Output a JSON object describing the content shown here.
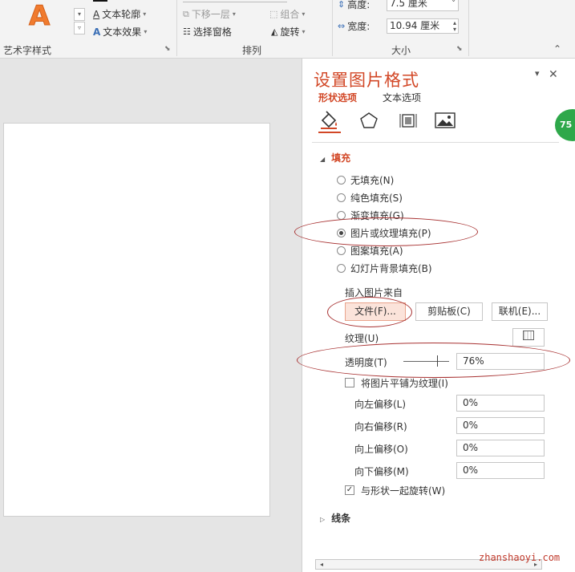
{
  "ribbon": {
    "wordart_group_label": "艺术字样式",
    "text_outline": "文本轮廓",
    "text_effects": "文本效果",
    "arrange_group_label": "排列",
    "send_backward": "下移一层",
    "group": "组合",
    "selection_pane": "选择窗格",
    "rotate": "旋转",
    "size_group_label": "大小",
    "height_label": "高度:",
    "height_value": "7.5 厘米",
    "width_label": "宽度:",
    "width_value": "10.94 厘米"
  },
  "pane": {
    "title": "设置图片格式",
    "tabs": [
      "形状选项",
      "文本选项"
    ],
    "fill_section": "填充",
    "fill_options": [
      "无填充(N)",
      "纯色填充(S)",
      "渐变填充(G)",
      "图片或纹理填充(P)",
      "图案填充(A)",
      "幻灯片背景填充(B)"
    ],
    "selected_fill": "图片或纹理填充(P)",
    "insert_from_label": "插入图片来自",
    "file_button": "文件(F)...",
    "clipboard_button": "剪贴板(C)",
    "online_button": "联机(E)...",
    "texture_label": "纹理(U)",
    "transparency_label": "透明度(T)",
    "transparency_value": "76%",
    "transparency_fraction": 0.76,
    "tile_label": "将图片平铺为纹理(I)",
    "tile_checked": false,
    "offsets": [
      {
        "label": "向左偏移(L)",
        "value": "0%"
      },
      {
        "label": "向右偏移(R)",
        "value": "0%"
      },
      {
        "label": "向上偏移(O)",
        "value": "0%"
      },
      {
        "label": "向下偏移(M)",
        "value": "0%"
      }
    ],
    "rotate_with_shape_label": "与形状一起旋转(W)",
    "rotate_with_shape_checked": true,
    "line_section": "线条"
  },
  "badge_text": "75",
  "watermark": "zhanshaoyi.com",
  "colors": {
    "accent": "#d24726",
    "annotation": "#a83232",
    "badge": "#2ea84a"
  }
}
